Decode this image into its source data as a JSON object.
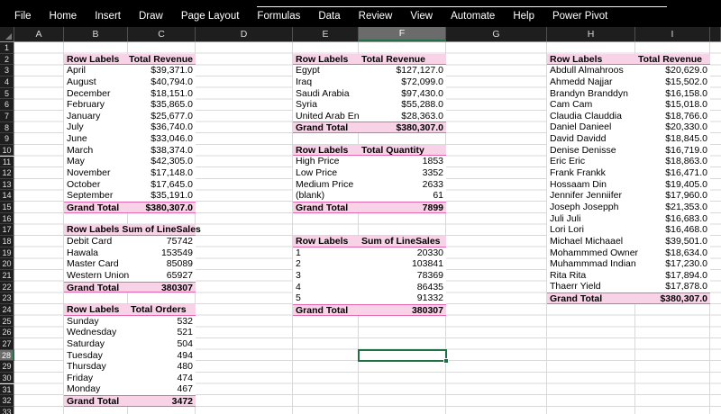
{
  "menu": {
    "items": [
      "File",
      "Home",
      "Insert",
      "Draw",
      "Page Layout",
      "Formulas",
      "Data",
      "Review",
      "View",
      "Automate",
      "Help",
      "Power Pivot"
    ]
  },
  "grid": {
    "columns": [
      "A",
      "B",
      "C",
      "D",
      "E",
      "F",
      "G",
      "H",
      "I"
    ],
    "rows_visible": 33,
    "selected_column": "F",
    "selected_row": 28,
    "active_cell": "F28"
  },
  "pivots": [
    {
      "header": [
        "Row Labels",
        "Total Revenue"
      ],
      "dropdown_glyph": "▼",
      "rows": [
        [
          "April",
          "$39,371.0"
        ],
        [
          "August",
          "$40,794.0"
        ],
        [
          "December",
          "$18,151.0"
        ],
        [
          "February",
          "$35,865.0"
        ],
        [
          "January",
          "$25,677.0"
        ],
        [
          "July",
          "$36,740.0"
        ],
        [
          "June",
          "$33,046.0"
        ],
        [
          "March",
          "$38,374.0"
        ],
        [
          "May",
          "$42,305.0"
        ],
        [
          "November",
          "$17,148.0"
        ],
        [
          "October",
          "$17,645.0"
        ],
        [
          "September",
          "$35,191.0"
        ]
      ],
      "grand_total": [
        "Grand Total",
        "$380,307.0"
      ]
    },
    {
      "header": [
        "Row Labels",
        "Sum of LineSales"
      ],
      "dropdown_glyph": "▼",
      "comment_flag": true,
      "rows": [
        [
          "Debit Card",
          "75742"
        ],
        [
          "Hawala",
          "153549"
        ],
        [
          "Master Card",
          "85089"
        ],
        [
          "Western Union",
          "65927"
        ]
      ],
      "grand_total": [
        "Grand Total",
        "380307"
      ]
    },
    {
      "header": [
        "Row Labels",
        "Total Orders"
      ],
      "dropdown_glyph": "--",
      "rows": [
        [
          "Sunday",
          "532"
        ],
        [
          "Wednesday",
          "521"
        ],
        [
          "Saturday",
          "504"
        ],
        [
          "Tuesday",
          "494"
        ],
        [
          "Thursday",
          "480"
        ],
        [
          "Friday",
          "474"
        ],
        [
          "Monday",
          "467"
        ]
      ],
      "grand_total": [
        "Grand Total",
        "3472"
      ]
    },
    {
      "header": [
        "Row Labels",
        "Total Revenue"
      ],
      "dropdown_glyph": "▼",
      "rows": [
        [
          "Egypt",
          "$127,127.0"
        ],
        [
          "Iraq",
          "$72,099.0"
        ],
        [
          "Saudi Arabia",
          "$97,430.0"
        ],
        [
          "Syria",
          "$55,288.0"
        ],
        [
          "United Arab En",
          "$28,363.0"
        ]
      ],
      "grand_total": [
        "Grand Total",
        "$380,307.0"
      ]
    },
    {
      "header": [
        "Row Labels",
        "Total Quantity"
      ],
      "dropdown_glyph": "▼",
      "rows": [
        [
          "High Price",
          "1853"
        ],
        [
          "Low Price",
          "3352"
        ],
        [
          "Medium Price",
          "2633"
        ],
        [
          "(blank)",
          "61"
        ]
      ],
      "grand_total": [
        "Grand Total",
        "7899"
      ]
    },
    {
      "header": [
        "Row Labels",
        "Sum of LineSales"
      ],
      "dropdown_glyph": "▼",
      "rows": [
        [
          "1",
          "20330"
        ],
        [
          "2",
          "103841"
        ],
        [
          "3",
          "78369"
        ],
        [
          "4",
          "86435"
        ],
        [
          "5",
          "91332"
        ]
      ],
      "grand_total": [
        "Grand Total",
        "380307"
      ]
    },
    {
      "header": [
        "Row Labels",
        "Total Revenue"
      ],
      "dropdown_glyph": "▼",
      "rows": [
        [
          "Abdull Almahroos",
          "$20,629.0"
        ],
        [
          "Ahmedd Najjar",
          "$15,502.0"
        ],
        [
          "Brandyn Branddyn",
          "$16,158.0"
        ],
        [
          "Cam Cam",
          "$15,018.0"
        ],
        [
          "Claudia Clauddia",
          "$18,766.0"
        ],
        [
          "Daniel Danieel",
          "$20,330.0"
        ],
        [
          "David Davidd",
          "$18,845.0"
        ],
        [
          "Denise Denisse",
          "$16,719.0"
        ],
        [
          "Eric Eric",
          "$18,863.0"
        ],
        [
          "Frank Frankk",
          "$16,471.0"
        ],
        [
          "Hossaam Din",
          "$19,405.0"
        ],
        [
          "Jennifer Jenniifer",
          "$17,960.0"
        ],
        [
          "Joseph Josepph",
          "$21,353.0"
        ],
        [
          "Juli Juli",
          "$16,683.0"
        ],
        [
          "Lori Lori",
          "$16,468.0"
        ],
        [
          "Michael Michaael",
          "$39,501.0"
        ],
        [
          "Mohammmed Owner",
          "$18,634.0"
        ],
        [
          "Muhammmad Indian",
          "$17,230.0"
        ],
        [
          "Rita Rita",
          "$17,894.0"
        ],
        [
          "Thaerr Yield",
          "$17,878.0"
        ]
      ],
      "grand_total": [
        "Grand Total",
        "$380,307.0"
      ]
    }
  ],
  "colors": {
    "menu_bar_bg": "#000000",
    "header_bg": "#1E1E1E",
    "header_selected_bg": "#6B6B6B",
    "selection_green": "#1E7145",
    "pivot_header_bg": "#F8D2E7",
    "pivot_accent_line": "#E466AC",
    "gridline": "#D9D9D9"
  }
}
